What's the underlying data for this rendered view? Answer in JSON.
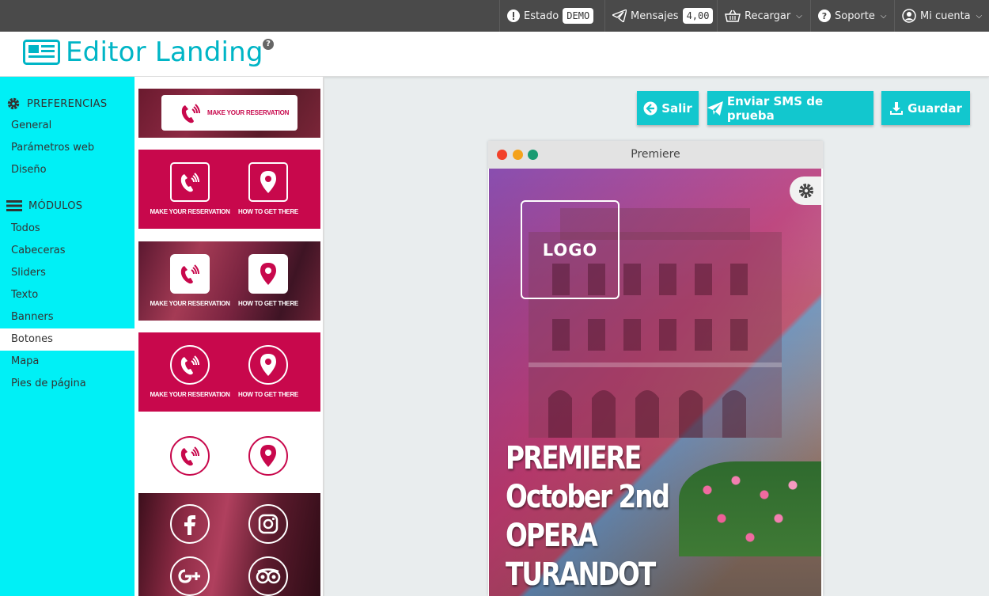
{
  "topbar": {
    "estado_label": "Estado",
    "estado_badge": "DEMO",
    "mensajes_label": "Mensajes",
    "mensajes_badge": "4,00",
    "recargar_label": "Recargar",
    "soporte_label": "Soporte",
    "cuenta_label": "Mi cuenta"
  },
  "header": {
    "title": "Editor Landing",
    "help": "?"
  },
  "sidebar": {
    "preferencias_title": "PREFERENCIAS",
    "preferencias_items": [
      "General",
      "Parámetros web",
      "Diseño"
    ],
    "modulos_title": "MÓDULOS",
    "modulos_items": [
      "Todos",
      "Cabeceras",
      "Sliders",
      "Texto",
      "Banners",
      "Botones",
      "Mapa",
      "Pies de página"
    ],
    "active_item": "Botones"
  },
  "modules": {
    "reservation_label": "MAKE YOUR RESERVATION",
    "directions_label": "HOW TO GET THERE"
  },
  "actions": {
    "salir": "Salir",
    "enviar_sms": "Enviar SMS de prueba",
    "guardar": "Guardar"
  },
  "preview": {
    "window_title": "Premiere",
    "logo_text": "LOGO",
    "headline": [
      "PREMIERE",
      "October 2nd",
      "OPERA",
      "TURANDOT"
    ]
  },
  "colors": {
    "accent": "#00b5c6",
    "sidebar_bg": "#00f0f6",
    "button_bg": "#12c7ce",
    "module_crimson": "#c8084c",
    "topbar_bg": "#4a4a4a"
  }
}
